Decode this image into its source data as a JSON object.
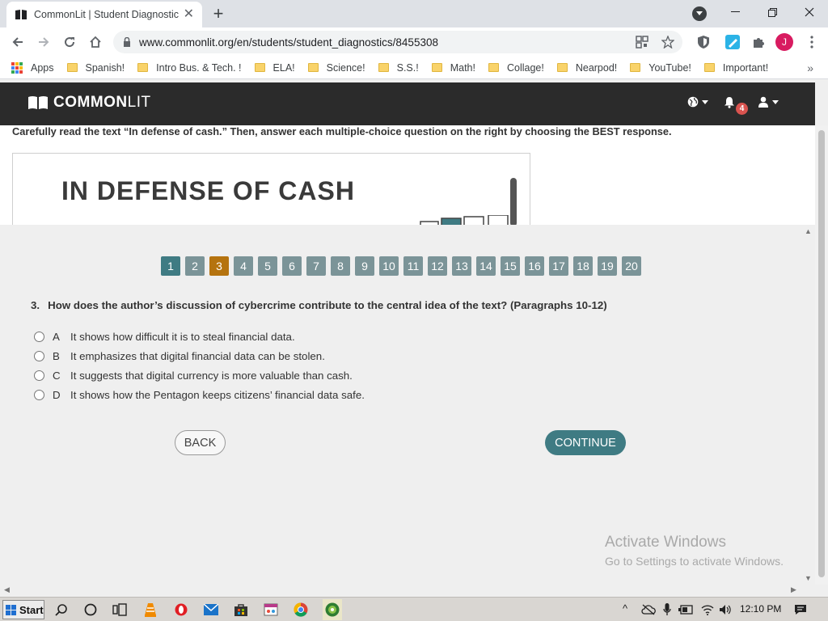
{
  "browser": {
    "tab_title": "CommonLit | Student Diagnostic",
    "url": "www.commonlit.org/en/students/student_diagnostics/8455308",
    "profile_initial": "J"
  },
  "bookmarks": {
    "apps_label": "Apps",
    "items": [
      "Spanish!",
      "Intro Bus. & Tech. !",
      "ELA!",
      "Science!",
      "S.S.!",
      "Math!",
      "Collage!",
      "Nearpod!",
      "YouTube!",
      "Important!"
    ]
  },
  "site": {
    "logo_bold": "COMMON",
    "logo_light": "LIT",
    "notification_count": "4"
  },
  "reading": {
    "instructions": "Carefully read the text “In defense of cash.” Then, answer each multiple-choice question on the right by choosing the BEST response.",
    "article_title": "IN DEFENSE OF CASH"
  },
  "question_nav": {
    "numbers": [
      "1",
      "2",
      "3",
      "4",
      "5",
      "6",
      "7",
      "8",
      "9",
      "10",
      "11",
      "12",
      "13",
      "14",
      "15",
      "16",
      "17",
      "18",
      "19",
      "20"
    ],
    "current": "3"
  },
  "question": {
    "number": "3.",
    "text": "How does the author’s discussion of cybercrime contribute to the central idea of the text? (Paragraphs 10-12)",
    "options": [
      {
        "letter": "A",
        "text": "It shows how difficult it is to steal financial data."
      },
      {
        "letter": "B",
        "text": "It emphasizes that digital financial data can be stolen."
      },
      {
        "letter": "C",
        "text": "It suggests that digital currency is more valuable than cash."
      },
      {
        "letter": "D",
        "text": "It shows how the Pentagon keeps citizens’ financial data safe."
      }
    ]
  },
  "buttons": {
    "back": "BACK",
    "continue": "CONTINUE"
  },
  "watermark": {
    "line1": "Activate Windows",
    "line2": "Go to Settings to activate Windows."
  },
  "taskbar": {
    "start": "Start",
    "time": "12:10 PM"
  },
  "colors": {
    "header": "#2b2b2b",
    "teal": "#3f7b83",
    "nav_number": "#7b9498",
    "active_number": "#b5730f"
  }
}
